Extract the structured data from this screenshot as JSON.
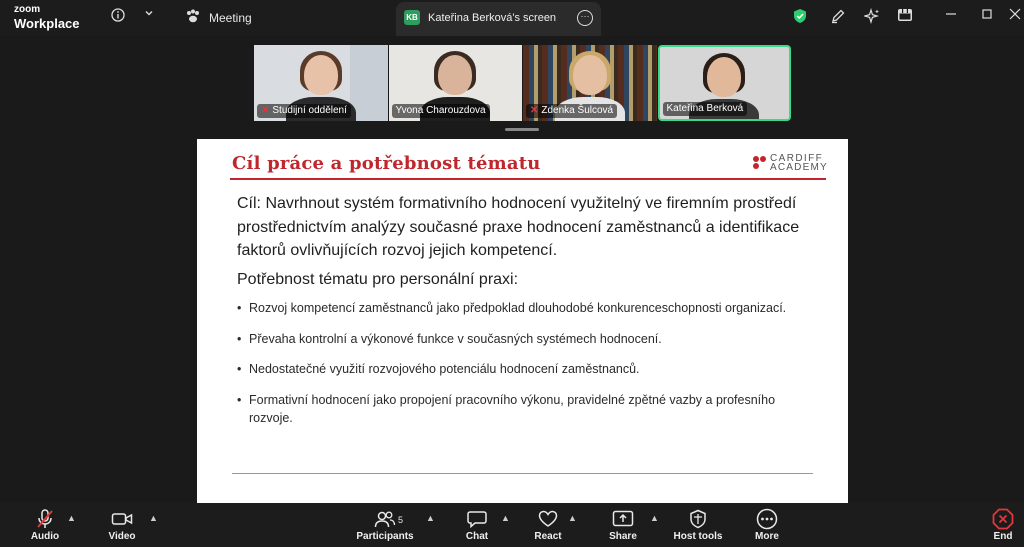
{
  "app": {
    "logo_line1": "zoom",
    "logo_line2": "Workplace"
  },
  "topbar": {
    "meeting_label": "Meeting"
  },
  "share_tab": {
    "initials": "KB",
    "label": "Kateřina Berková's screen"
  },
  "participants_strip": [
    {
      "name": "Studijní oddělení",
      "muted": true,
      "active": false
    },
    {
      "name": "Yvona Charouzdova",
      "muted": false,
      "active": false
    },
    {
      "name": "Zdenka Šulcová",
      "muted": true,
      "active": false
    },
    {
      "name": "Kateřina Berková",
      "muted": false,
      "active": true
    }
  ],
  "slide": {
    "title": "Cíl práce a potřebnost tématu",
    "brand_line1": "CARDIFF",
    "brand_line2": "ACADEMY",
    "goal_text": "Cíl: Navrhnout systém formativního hodnocení využitelný ve firemním prostředí prostřednictvím analýzy současné praxe hodnocení zaměstnanců a identifikace faktorů ovlivňujících rozvoj jejich kompetencí.",
    "subheading": "Potřebnost tématu pro personální praxi:",
    "bullets": [
      "Rozvoj kompetencí zaměstnanců jako předpoklad dlouhodobé konkurenceschopnosti organizací.",
      "Převaha kontrolní a výkonové funkce v současných systémech hodnocení.",
      "Nedostatečné využití rozvojového potenciálu hodnocení zaměstnanců.",
      "Formativní hodnocení jako propojení pracovního výkonu, pravidelné zpětné vazby a profesního rozvoje."
    ]
  },
  "toolbar": {
    "audio": "Audio",
    "video": "Video",
    "participants": "Participants",
    "participants_count": "5",
    "chat": "Chat",
    "react": "React",
    "share": "Share",
    "host_tools": "Host tools",
    "more": "More",
    "end": "End"
  },
  "colors": {
    "accent": "#c0272d",
    "active_tile": "#3bd98b",
    "shield": "#2ecc71",
    "end": "#e0383e"
  }
}
